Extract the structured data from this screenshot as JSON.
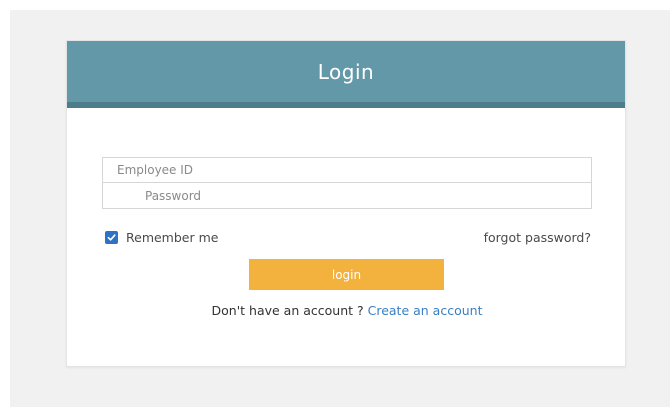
{
  "login": {
    "title": "Login",
    "employee_id_placeholder": "Employee ID",
    "password_placeholder": "Password",
    "remember_label": "Remember me",
    "remember_checked": true,
    "forgot_label": "forgot password?",
    "button_label": "login",
    "signup_prompt": "Don't have an account ?",
    "create_account_label": "Create an account"
  },
  "colors": {
    "header": "#6298a8",
    "button": "#f2b23d",
    "link": "#3a7fc1",
    "checkbox": "#2f72c5"
  }
}
